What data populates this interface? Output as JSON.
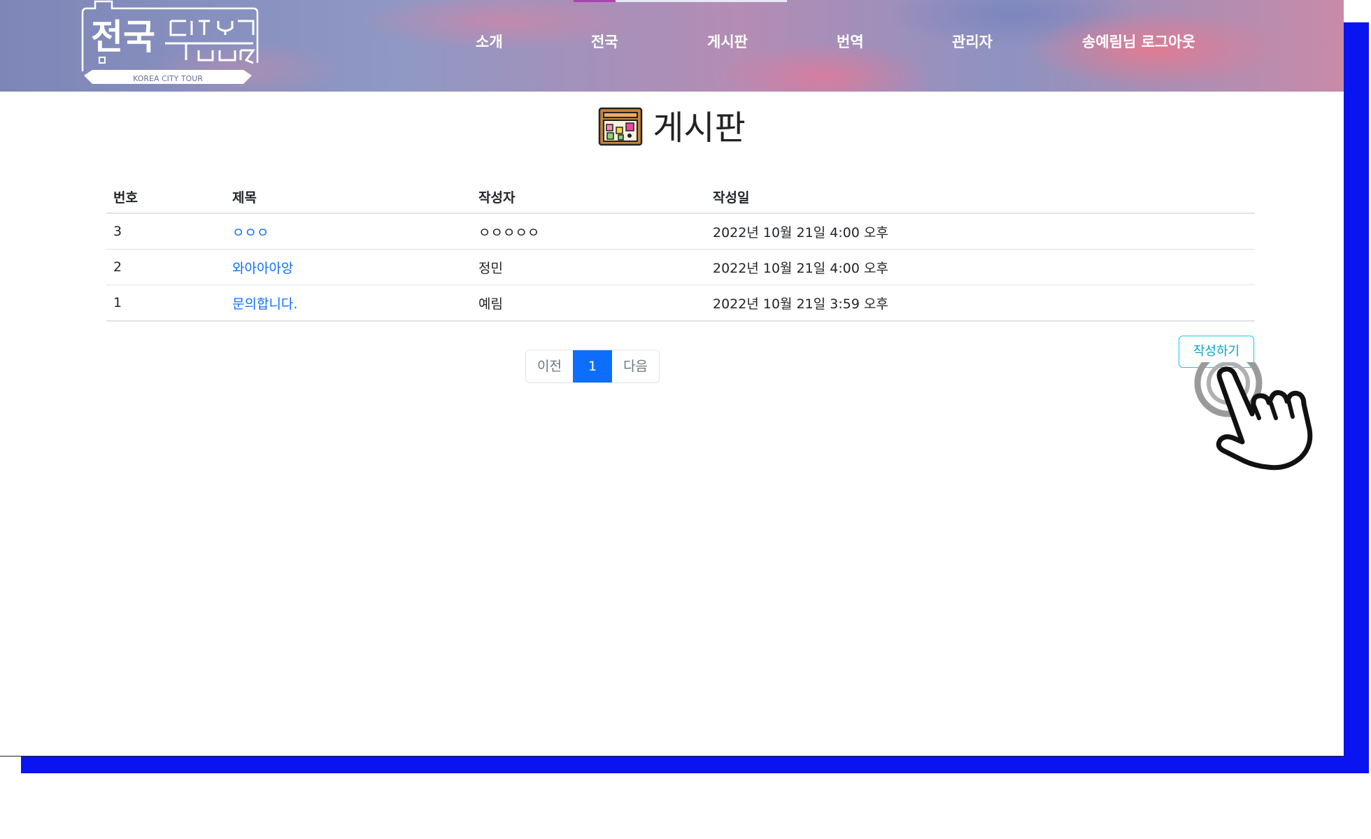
{
  "header": {
    "logo": {
      "text_main": "전국",
      "text_sub": "CITY TOUR",
      "caption": "KOREA CITY TOUR"
    },
    "nav": [
      {
        "label": "소개"
      },
      {
        "label": "전국"
      },
      {
        "label": "게시판"
      },
      {
        "label": "번역"
      },
      {
        "label": "관리자"
      },
      {
        "label": "송예림님 로그아웃"
      }
    ]
  },
  "page": {
    "title": "게시판",
    "title_icon": "bulletin-board-icon"
  },
  "table": {
    "headers": [
      "번호",
      "제목",
      "작성자",
      "작성일"
    ],
    "rows": [
      {
        "no": "3",
        "title": "ㅇㅇㅇ",
        "author": "ㅇㅇㅇㅇㅇ",
        "date": "2022년 10월 21일 4:00 오후"
      },
      {
        "no": "2",
        "title": "와아아아앙",
        "author": "정민",
        "date": "2022년 10월 21일 4:00 오후"
      },
      {
        "no": "1",
        "title": "문의합니다.",
        "author": "예림",
        "date": "2022년 10월 21일 3:59 오후"
      }
    ]
  },
  "pagination": {
    "prev": "이전",
    "current": "1",
    "next": "다음"
  },
  "actions": {
    "write": "작성하기"
  },
  "colors": {
    "accent": "#0d6efd",
    "frame": "#0a14f0",
    "write_button": "#0dcaf0"
  }
}
